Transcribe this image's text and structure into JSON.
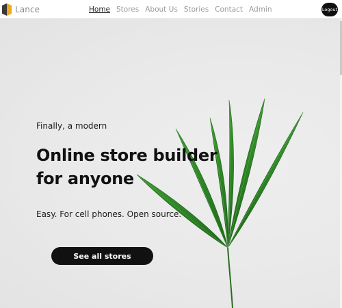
{
  "brand": {
    "name": "Lance",
    "logo_icon": "lance-logo-icon"
  },
  "nav": {
    "items": [
      {
        "label": "Home",
        "active": true
      },
      {
        "label": "Stores",
        "active": false
      },
      {
        "label": "About Us",
        "active": false
      },
      {
        "label": "Stories",
        "active": false
      },
      {
        "label": "Contact",
        "active": false
      },
      {
        "label": "Admin",
        "active": false
      }
    ],
    "logout_label": "Logout"
  },
  "hero": {
    "eyebrow": "Finally, a modern",
    "headline_line1": "Online store builder",
    "headline_line2": "for anyone",
    "tagline": "Easy. For cell phones. Open source.",
    "cta_label": "See all stores",
    "image_icon": "palm-leaf-plant-image"
  },
  "colors": {
    "accent_dark": "#111111",
    "logo_orange": "#f0a81c",
    "logo_dark": "#3a3a3a",
    "leaf_green": "#2f8a2a",
    "nav_muted": "#9a9a9a"
  }
}
